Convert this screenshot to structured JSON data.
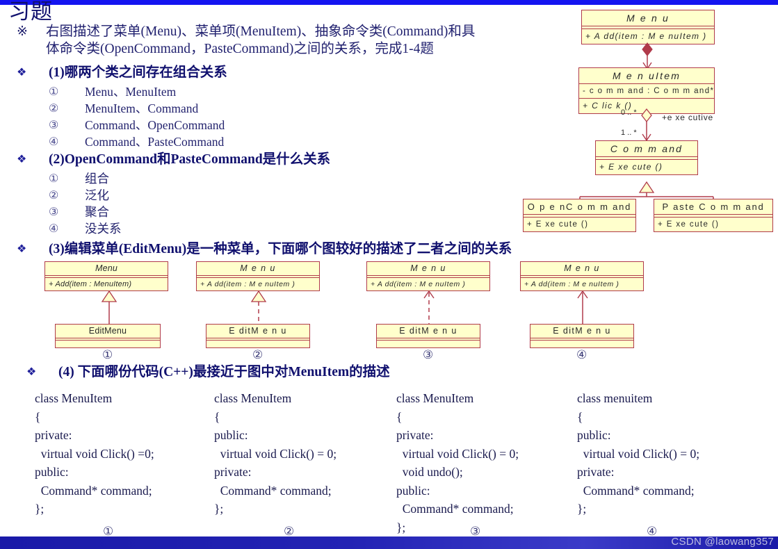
{
  "slide": {
    "title": "习题",
    "watermark": "CSDN @laowang357",
    "accent_blue": "#1414f0",
    "bar_navy": "#1a1aa8",
    "text_navy": "#10106e",
    "uml_fill": "#ffffcc",
    "uml_border": "#b03a4a"
  },
  "intro": {
    "marker": "※",
    "line1": "右图描述了菜单(Menu)、菜单项(MenuItem)、抽象命令类(Command)和具",
    "line2": "体命令类(OpenCommand，PasteCommand)之间的关系，完成1-4题"
  },
  "questions": [
    {
      "bullet": "❖",
      "heading": "(1)哪两个类之间存在组合关系",
      "options": [
        {
          "num": "①",
          "label": "Menu、MenuItem"
        },
        {
          "num": "②",
          "label": "MenuItem、Command"
        },
        {
          "num": "③",
          "label": "Command、OpenCommand"
        },
        {
          "num": "④",
          "label": "Command、PasteCommand"
        }
      ]
    },
    {
      "bullet": "❖",
      "heading": "(2)OpenCommand和PasteCommand是什么关系",
      "options": [
        {
          "num": "①",
          "label": "组合"
        },
        {
          "num": "②",
          "label": "泛化"
        },
        {
          "num": "③",
          "label": "聚合"
        },
        {
          "num": "④",
          "label": "没关系"
        }
      ]
    },
    {
      "bullet": "❖",
      "heading": "(3)编辑菜单(EditMenu)是一种菜单，下面哪个图较好的描述了二者之间的关系"
    },
    {
      "bullet": "❖",
      "heading": "(4) 下面哪份代码(C++)最接近于图中对MenuItem的描述"
    }
  ],
  "main_diagram": {
    "classes": {
      "menu": {
        "name": "M e n u",
        "operation": "+   A dd(item   :   M e nuItem )"
      },
      "menuitem": {
        "name": "M e n uItem",
        "attribute": "-  c o m m and  :  C o m m and*",
        "operation": "+   C lic k ()"
      },
      "command": {
        "name": "C o m m and",
        "operation": "+   E xe cute ()"
      },
      "opencommand": {
        "name": "O p e nC o m m and",
        "operation": "+   E xe cute ()"
      },
      "pastecommand": {
        "name": "P aste C o m m and",
        "operation": "+   E xe cute ()"
      }
    },
    "labels": {
      "mult_source": "0 .. *",
      "mult_target": "1 .. *",
      "role": "+e xe cutive"
    },
    "relations": [
      {
        "from": "menu",
        "to": "menuitem",
        "type": "composition"
      },
      {
        "from": "menuitem",
        "to": "command",
        "type": "aggregation"
      },
      {
        "from": "command",
        "to": "opencommand",
        "type": "generalization"
      },
      {
        "from": "command",
        "to": "pastecommand",
        "type": "generalization"
      }
    ]
  },
  "q3_diagrams": [
    {
      "num": "①",
      "parent": {
        "name": "Menu",
        "operation": "+ Add(item : MenuItem)"
      },
      "child": {
        "name": "EditMenu"
      },
      "relation": "solid-hollow-triangle"
    },
    {
      "num": "②",
      "parent": {
        "name": "M e n u",
        "operation": "+   A dd(item   :   M e nuItem )"
      },
      "child": {
        "name": "E ditM e n u"
      },
      "relation": "dashed-hollow-triangle"
    },
    {
      "num": "③",
      "parent": {
        "name": "M e n u",
        "operation": "+   A dd(item   :   M e nuItem )"
      },
      "child": {
        "name": "E ditM e n u"
      },
      "relation": "dashed-open-arrow"
    },
    {
      "num": "④",
      "parent": {
        "name": "M e n u",
        "operation": "+   A dd(item   :   M e nuItem )"
      },
      "child": {
        "name": "E ditM e n u"
      },
      "relation": "solid-open-arrow"
    }
  ],
  "q4_code": [
    {
      "num": "①",
      "lines": "class MenuItem\n{\nprivate:\n  virtual void Click() =0;\npublic:\n  Command* command;\n};"
    },
    {
      "num": "②",
      "lines": "class MenuItem\n{\npublic:\n  virtual void Click() = 0;\nprivate:\n  Command* command;\n};"
    },
    {
      "num": "③",
      "lines": "class MenuItem\n{\nprivate:\n  virtual void Click() = 0;\n  void undo();\npublic:\n  Command* command;\n};"
    },
    {
      "num": "④",
      "lines": "class menuitem\n{\npublic:\n  virtual void Click() = 0;\nprivate:\n  Command* command;\n};"
    }
  ]
}
